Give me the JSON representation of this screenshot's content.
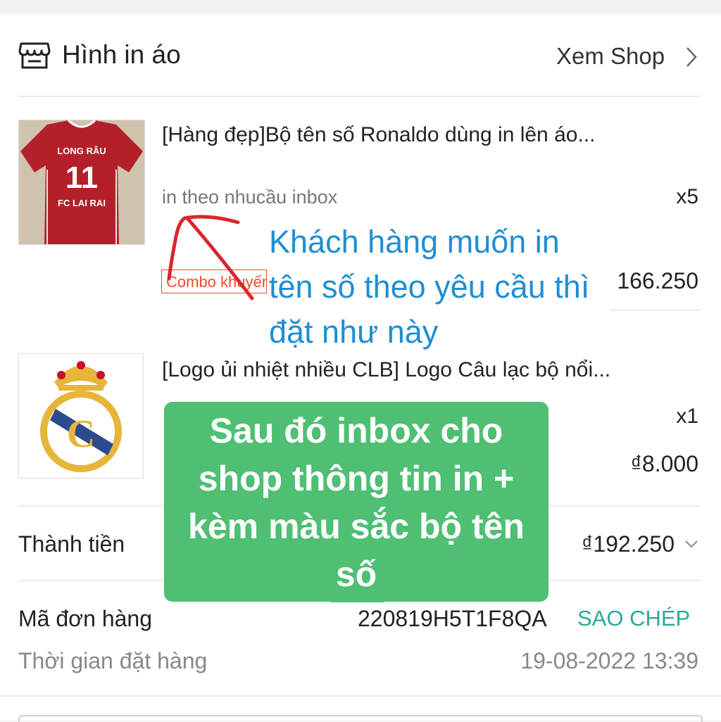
{
  "shop": {
    "name": "Hình in áo",
    "view_shop_label": "Xem Shop"
  },
  "products": [
    {
      "title": "[Hàng đẹp]Bộ tên số Ronaldo dùng in lên áo...",
      "variant": "in theo nhucầu inbox",
      "quantity": "x5",
      "price": "166.250",
      "tag": "Combo khuyến mãi",
      "image_text": [
        "LONG RÂU",
        "11",
        "FC LAI RAI"
      ]
    },
    {
      "title": "[Logo ủi nhiệt nhiều CLB] Logo Câu lạc bộ nổi...",
      "quantity": "x1",
      "price": "₫8.000"
    }
  ],
  "order": {
    "total_label": "Thành tiền",
    "total_value": "₫192.250",
    "order_id_label": "Mã đơn hàng",
    "order_id": "220819H5T1F8QA",
    "copy_label": "SAO CHÉP",
    "order_time_label": "Thời gian đặt hàng",
    "order_time": "19-08-2022 13:39"
  },
  "annotations": {
    "blue_note": "Khách hàng muốn in tên số theo yêu cầu thì đặt như này",
    "green_note": "Sau đó inbox cho shop thông tin in + kèm màu sắc bộ tên số"
  },
  "colors": {
    "accent_orange": "#ee4d2d",
    "copy_teal": "#26aa99",
    "note_blue": "#1f8ed3",
    "note_green": "#4ebf73",
    "arrow_red": "#d9262c"
  }
}
